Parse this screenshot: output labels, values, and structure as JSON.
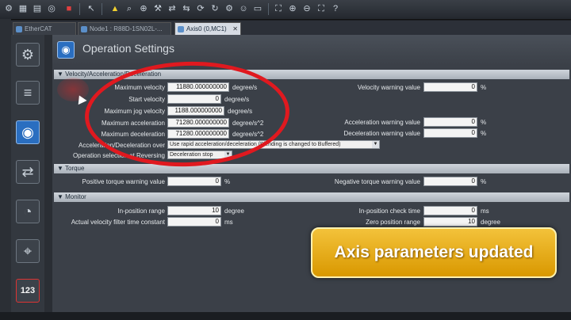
{
  "tabs": [
    {
      "label": "EtherCAT",
      "active": false
    },
    {
      "label": "Node1 : R88D-1SN02L-...",
      "active": false
    },
    {
      "label": "Axis0 (0,MC1)",
      "active": true
    }
  ],
  "header": {
    "title": "Operation Settings"
  },
  "sections": {
    "velocity": "▼ Velocity/Acceleration/Deceleration",
    "torque": "▼ Torque",
    "monitor": "▼ Monitor"
  },
  "velocity": {
    "max_velocity": {
      "label": "Maximum velocity",
      "value": "11880.000000000",
      "unit": "degree/s"
    },
    "start_velocity": {
      "label": "Start velocity",
      "value": "0",
      "unit": "degree/s"
    },
    "max_jog_velocity": {
      "label": "Maximum jog velocity",
      "value": "1188.000000000",
      "unit": "degree/s"
    },
    "max_acceleration": {
      "label": "Maximum acceleration",
      "value": "71280.000000000",
      "unit": "degree/s^2"
    },
    "max_deceleration": {
      "label": "Maximum deceleration",
      "value": "71280.000000000",
      "unit": "degree/s^2"
    },
    "velocity_warning": {
      "label": "Velocity warning value",
      "value": "0",
      "unit": "%"
    },
    "acceleration_warning": {
      "label": "Acceleration warning value",
      "value": "0",
      "unit": "%"
    },
    "deceleration_warning": {
      "label": "Deceleration warning value",
      "value": "0",
      "unit": "%"
    },
    "accel_over": {
      "label": "Acceleration/Deceleration over",
      "value": "Use rapid acceleration/deceleration (Blending is changed to Buffered)"
    },
    "op_reversing": {
      "label": "Operation selection at Reversing",
      "value": "Deceleration stop"
    }
  },
  "torque": {
    "positive": {
      "label": "Positive torque warning value",
      "value": "0",
      "unit": "%"
    },
    "negative": {
      "label": "Negative torque warning value",
      "value": "0",
      "unit": "%"
    }
  },
  "monitor": {
    "inpos_range": {
      "label": "In-position range",
      "value": "10",
      "unit": "degree"
    },
    "inpos_check": {
      "label": "In-position check time",
      "value": "0",
      "unit": "ms"
    },
    "vel_filter": {
      "label": "Actual velocity filter time constant",
      "value": "0",
      "unit": "ms"
    },
    "zero_range": {
      "label": "Zero position range",
      "value": "10",
      "unit": "degree"
    }
  },
  "sidebar": {
    "counter_label": "123"
  },
  "banner": {
    "text": "Axis parameters updated"
  },
  "colors": {
    "accent": "#2a6ec0",
    "highlight": "#e0191f",
    "banner": "#e8ae14"
  }
}
